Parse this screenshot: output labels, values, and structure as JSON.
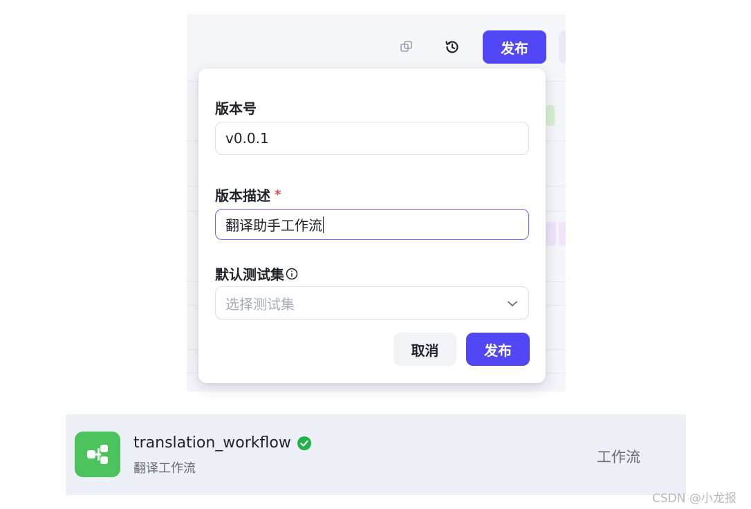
{
  "toolbar": {
    "copy_icon": "copy-icon",
    "history_icon": "history-icon",
    "publish_label": "发布"
  },
  "publish_dialog": {
    "version": {
      "label": "版本号",
      "value": "v0.0.1"
    },
    "description": {
      "label": "版本描述",
      "required_mark": "*",
      "value": "翻译助手工作流"
    },
    "test_set": {
      "label": "默认测试集",
      "info_icon": "info-icon",
      "placeholder": "选择测试集",
      "chevron_icon": "chevron-down-icon"
    },
    "cancel_label": "取消",
    "publish_label": "发布"
  },
  "workflow_card": {
    "icon": "workflow-icon",
    "name": "translation_workflow",
    "status_icon": "check-circle-icon",
    "description": "翻译工作流",
    "type": "工作流"
  },
  "watermark": "CSDN @小龙报",
  "colors": {
    "accent": "#5147f5",
    "required": "#e5484d",
    "success": "#21b34a",
    "workflow_icon_bg": "#4cc25c"
  }
}
